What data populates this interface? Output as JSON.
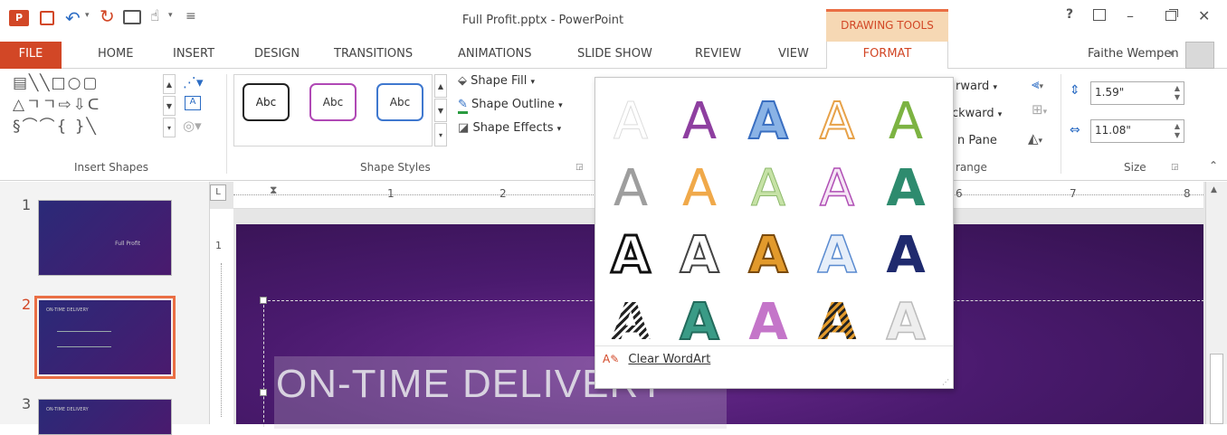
{
  "window": {
    "title": "Full Profit.pptx - PowerPoint",
    "contextual_group": "DRAWING TOOLS",
    "user": "Faithe Wempen"
  },
  "quick_access": {
    "customize": "≡"
  },
  "window_controls": {
    "help": "?",
    "minimize": "–",
    "close": "✕"
  },
  "tabs": [
    {
      "label": "FILE"
    },
    {
      "label": "HOME"
    },
    {
      "label": "INSERT"
    },
    {
      "label": "DESIGN"
    },
    {
      "label": "TRANSITIONS"
    },
    {
      "label": "ANIMATIONS"
    },
    {
      "label": "SLIDE SHOW"
    },
    {
      "label": "REVIEW"
    },
    {
      "label": "VIEW"
    },
    {
      "label": "FORMAT"
    }
  ],
  "ribbon": {
    "insert_shapes_label": "Insert Shapes",
    "shape_styles_label": "Shape Styles",
    "style_thumbs": [
      "Abc",
      "Abc",
      "Abc"
    ],
    "shape_fill": "Shape Fill",
    "shape_outline": "Shape Outline",
    "shape_effects": "Shape Effects",
    "arrange_forward": "rward",
    "arrange_backward": "ckward",
    "arrange_pane": "n Pane",
    "arrange_label": "range",
    "size_height": "1.59\"",
    "size_width": "11.08\"",
    "size_label": "Size"
  },
  "slides": [
    {
      "number": "1",
      "title": "Full Profit"
    },
    {
      "number": "2",
      "title": "ON-TIME DELIVERY"
    },
    {
      "number": "3",
      "title": "ON-TIME DELIVERY"
    }
  ],
  "ruler": {
    "l_marker": "L",
    "numbers": [
      "1",
      "2",
      "6",
      "7",
      "8"
    ],
    "v_number": "1"
  },
  "slide_title": "ON-TIME DELIVERY",
  "gallery": {
    "clear_wordart": "Clear WordArt",
    "letter": "A"
  },
  "colors": {
    "accent_ppt": "#d24726",
    "contextual": "#f6d8b4",
    "file_tab": "#d24726",
    "selection": "#ea6e44"
  }
}
